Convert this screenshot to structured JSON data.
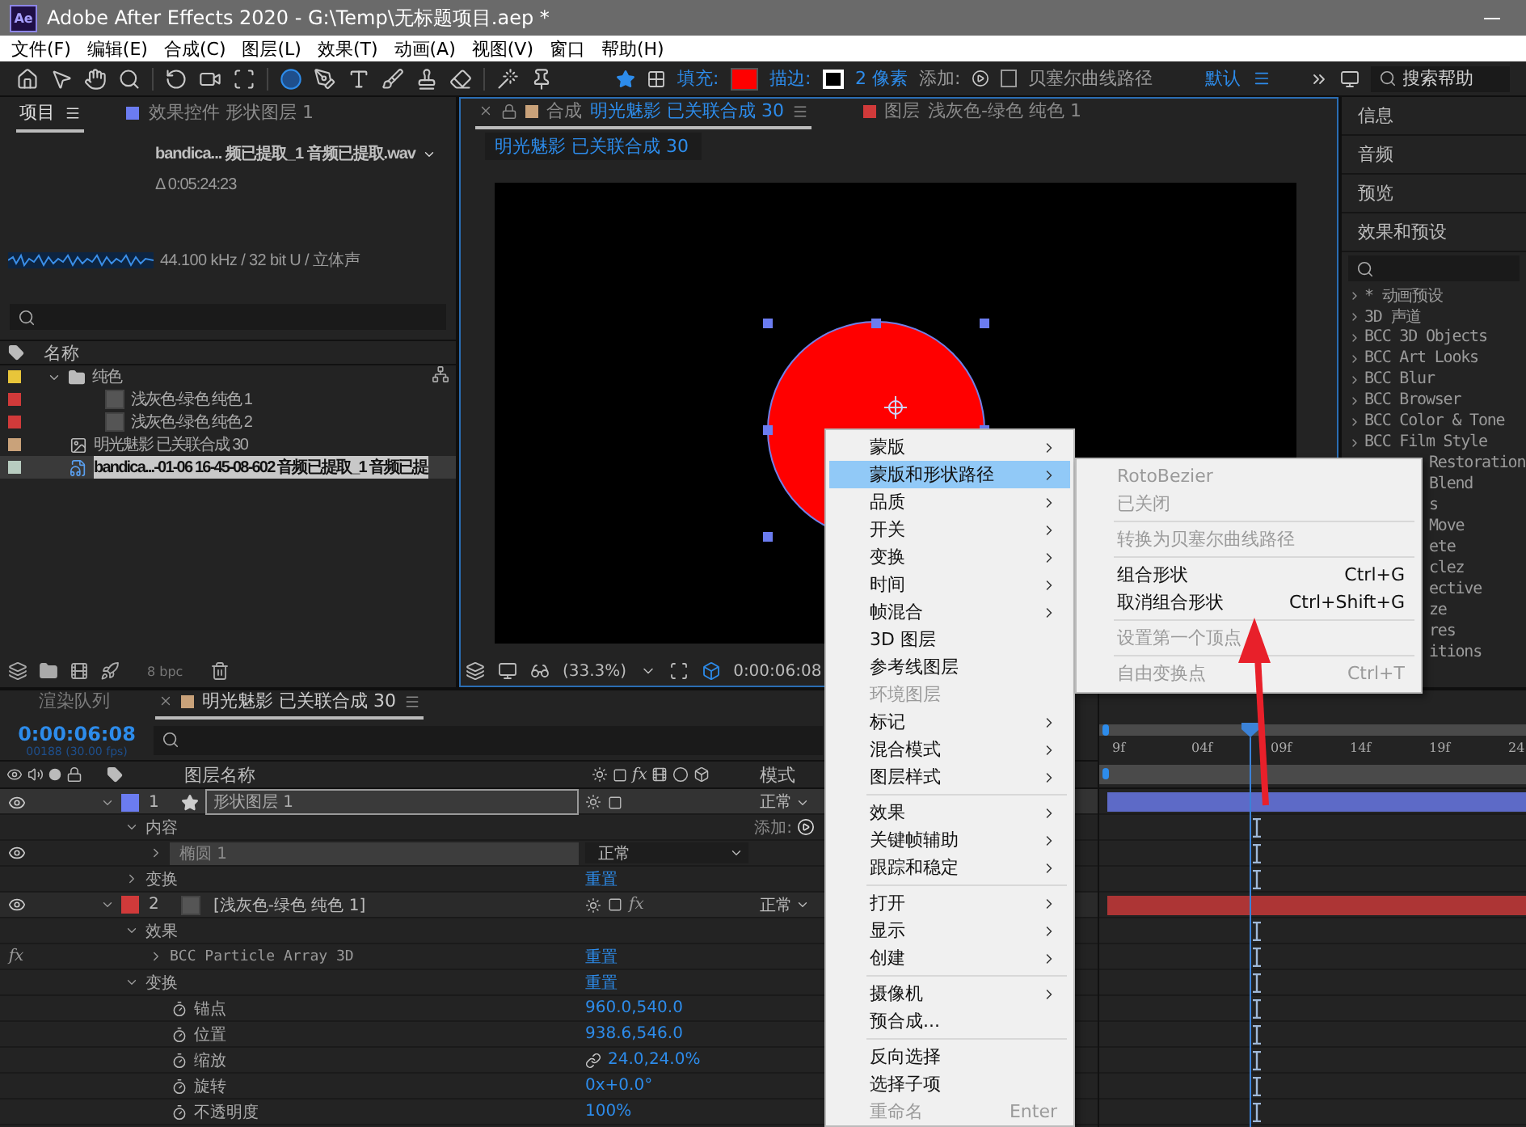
{
  "window": {
    "logo": "Ae",
    "title": "Adobe After Effects 2020 - G:\\Temp\\无标题项目.aep *"
  },
  "menu_bar": [
    "文件(F)",
    "编辑(E)",
    "合成(C)",
    "图层(L)",
    "效果(T)",
    "动画(A)",
    "视图(V)",
    "窗口",
    "帮助(H)"
  ],
  "toolbar": {
    "tools": [
      {
        "kind": "home",
        "selected": false
      },
      {
        "kind": "select",
        "selected": false
      },
      {
        "kind": "hand",
        "selected": false
      },
      {
        "kind": "zoom",
        "selected": false
      },
      {
        "kind": "rotate",
        "selected": false
      },
      {
        "kind": "camera",
        "selected": false
      },
      {
        "kind": "pan",
        "selected": false
      },
      {
        "kind": "ellipse",
        "selected": true
      },
      {
        "kind": "pen",
        "selected": false
      },
      {
        "kind": "text",
        "selected": false
      },
      {
        "kind": "brush",
        "selected": false
      },
      {
        "kind": "stamp",
        "selected": false
      },
      {
        "kind": "eraser",
        "selected": false
      },
      {
        "kind": "roto",
        "selected": false
      },
      {
        "kind": "pin",
        "selected": false
      }
    ],
    "fill_label": "填充:",
    "stroke_label": "描边:",
    "stroke_width": "2 像素",
    "add_label": "添加:",
    "bezier": {
      "label": "贝塞尔曲线路径",
      "checked": false
    },
    "workspace": "默认",
    "search": {
      "placeholder": "搜索帮助"
    }
  },
  "project_panel": {
    "tabs": [
      {
        "label": "项目",
        "selected": true
      },
      {
        "label": "效果控件 形状图层 1",
        "selected": false
      }
    ],
    "file_name": "bandica... 频已提取_1 音频已提取.wav",
    "duration": "Δ 0:05:24:23",
    "audio_info": "44.100 kHz / 32 bit U / 立体声",
    "column": "名称",
    "items": [
      {
        "kind": "folder",
        "name": "纯色",
        "color": "#e8c53a",
        "expanded": true,
        "selected": false,
        "children": [
          {
            "kind": "solid",
            "name": "浅灰色-绿色 纯色 1",
            "color": "#d03a3a",
            "selected": false
          },
          {
            "kind": "solid",
            "name": "浅灰色-绿色 纯色 2",
            "color": "#d03a3a",
            "selected": false
          }
        ]
      },
      {
        "kind": "comp",
        "name": "明光魅影 已关联合成 30",
        "color": "#c9a27a",
        "selected": false
      },
      {
        "kind": "audio",
        "name": "bandica...-01-06 16-45-08-602 音频已提取_1 音频已提",
        "color": "#b8ccc0",
        "selected": true
      }
    ],
    "bit_depth": "8 bpc"
  },
  "composition_panel": {
    "tabs": [
      {
        "prefix": "合成",
        "name": "明光魅影 已关联合成 30",
        "color": "#c9a27a",
        "selected": true
      },
      {
        "prefix": "图层",
        "name": "浅灰色-绿色 纯色 1",
        "color": "#d03a3a",
        "selected": false
      }
    ],
    "breadcrumb": "明光魅影 已关联合成 30",
    "zoom": "(33.3%)",
    "timecode": "0:00:06:08"
  },
  "side_panels": {
    "sections": [
      "信息",
      "音频",
      "预览"
    ],
    "effects_title": "效果和预设",
    "effects": [
      {
        "kind": "full",
        "label": "* 动画预设"
      },
      {
        "kind": "full",
        "label": "3D 声道"
      },
      {
        "kind": "full",
        "label": "BCC 3D Objects"
      },
      {
        "kind": "full",
        "label": "BCC Art Looks"
      },
      {
        "kind": "full",
        "label": "BCC Blur"
      },
      {
        "kind": "full",
        "label": "BCC Browser"
      },
      {
        "kind": "full",
        "label": "BCC Color & Tone"
      },
      {
        "kind": "full",
        "label": "BCC Film Style"
      },
      {
        "kind": "cut",
        "label": "Restoration"
      },
      {
        "kind": "cut",
        "label": "Blend"
      },
      {
        "kind": "cut",
        "label": "s"
      },
      {
        "kind": "cut",
        "label": "Move"
      },
      {
        "kind": "cut",
        "label": "ete"
      },
      {
        "kind": "cut",
        "label": "clez"
      },
      {
        "kind": "cut",
        "label": "ective"
      },
      {
        "kind": "cut",
        "label": "ze"
      },
      {
        "kind": "cut",
        "label": "res"
      },
      {
        "kind": "cut",
        "label": "itions"
      }
    ]
  },
  "timeline": {
    "tabs": [
      {
        "label": "渲染队列",
        "selected": false
      },
      {
        "label": "明光魅影 已关联合成 30",
        "color": "#c9a27a",
        "selected": true
      }
    ],
    "current_time": "0:00:06:08",
    "frame_info": "00188 (30.00 fps)",
    "columns": {
      "name": "图层名称",
      "effects": "fx",
      "mode": "模式"
    },
    "ruler": [
      "9f",
      "04f",
      "09f",
      "14f",
      "19f",
      "24"
    ],
    "layers": [
      {
        "kind": "shape_layer",
        "number": "1",
        "name": "形状图层 1",
        "color": "#6b7cf0",
        "visible": true,
        "selected": true,
        "expanded": true,
        "mode": "正常",
        "children": [
          {
            "kind": "group",
            "name": "内容",
            "expanded": true,
            "add_label": "添加:",
            "children": [
              {
                "kind": "shape",
                "name": "椭圆 1",
                "visible": true,
                "expanded": false,
                "mode": "正常"
              }
            ]
          },
          {
            "kind": "group",
            "name": "变换",
            "expanded": false,
            "value": "重置"
          }
        ]
      },
      {
        "kind": "solid_layer",
        "number": "2",
        "name": "[浅灰色-绿色 纯色 1]",
        "color": "#d03a3a",
        "visible": true,
        "selected": false,
        "expanded": true,
        "mode": "正常",
        "fx": "fx",
        "children": [
          {
            "kind": "group",
            "name": "效果",
            "expanded": true,
            "children": [
              {
                "kind": "effect",
                "badge": "fx",
                "name": "BCC Particle Array 3D",
                "expanded": false,
                "value": "重置"
              }
            ]
          },
          {
            "kind": "group",
            "name": "变换",
            "expanded": true,
            "value": "重置",
            "children": [
              {
                "kind": "property",
                "name": "锚点",
                "value": "960.0,540.0",
                "linked": false
              },
              {
                "kind": "property",
                "name": "位置",
                "value": "938.6,546.0",
                "linked": false
              },
              {
                "kind": "property",
                "name": "缩放",
                "value": "24.0,24.0%",
                "linked": true
              },
              {
                "kind": "property",
                "name": "旋转",
                "value": "0x+0.0°",
                "linked": false
              },
              {
                "kind": "property",
                "name": "不透明度",
                "value": "100%",
                "linked": false
              }
            ]
          }
        ]
      }
    ]
  },
  "context_menu": {
    "items": [
      {
        "kind": "submenu",
        "label": "蒙版",
        "selected": false,
        "disabled": false
      },
      {
        "kind": "submenu",
        "label": "蒙版和形状路径",
        "selected": true,
        "disabled": false
      },
      {
        "kind": "submenu",
        "label": "品质",
        "selected": false,
        "disabled": false
      },
      {
        "kind": "submenu",
        "label": "开关",
        "selected": false,
        "disabled": false
      },
      {
        "kind": "submenu",
        "label": "变换",
        "selected": false,
        "disabled": false
      },
      {
        "kind": "submenu",
        "label": "时间",
        "selected": false,
        "disabled": false
      },
      {
        "kind": "submenu",
        "label": "帧混合",
        "selected": false,
        "disabled": false
      },
      {
        "kind": "item",
        "label": "3D 图层",
        "selected": false,
        "disabled": false
      },
      {
        "kind": "item",
        "label": "参考线图层",
        "selected": false,
        "disabled": false
      },
      {
        "kind": "item",
        "label": "环境图层",
        "selected": false,
        "disabled": true
      },
      {
        "kind": "submenu",
        "label": "标记",
        "selected": false,
        "disabled": false
      },
      {
        "kind": "submenu",
        "label": "混合模式",
        "selected": false,
        "disabled": false
      },
      {
        "kind": "submenu",
        "label": "图层样式",
        "selected": false,
        "disabled": false
      },
      {
        "kind": "separator"
      },
      {
        "kind": "submenu",
        "label": "效果",
        "selected": false,
        "disabled": false
      },
      {
        "kind": "submenu",
        "label": "关键帧辅助",
        "selected": false,
        "disabled": false
      },
      {
        "kind": "submenu",
        "label": "跟踪和稳定",
        "selected": false,
        "disabled": false
      },
      {
        "kind": "separator"
      },
      {
        "kind": "submenu",
        "label": "打开",
        "selected": false,
        "disabled": false
      },
      {
        "kind": "submenu",
        "label": "显示",
        "selected": false,
        "disabled": false
      },
      {
        "kind": "submenu",
        "label": "创建",
        "selected": false,
        "disabled": false
      },
      {
        "kind": "separator"
      },
      {
        "kind": "submenu",
        "label": "摄像机",
        "selected": false,
        "disabled": false
      },
      {
        "kind": "item",
        "label": "预合成...",
        "selected": false,
        "disabled": false
      },
      {
        "kind": "separator"
      },
      {
        "kind": "item",
        "label": "反向选择",
        "selected": false,
        "disabled": false
      },
      {
        "kind": "item",
        "label": "选择子项",
        "selected": false,
        "disabled": false
      },
      {
        "kind": "item",
        "label": "重命名",
        "shortcut": "Enter",
        "selected": false,
        "disabled": true
      }
    ]
  },
  "submenu": {
    "items": [
      {
        "kind": "item",
        "label": "RotoBezier",
        "disabled": true
      },
      {
        "kind": "item",
        "label": "已关闭",
        "disabled": true
      },
      {
        "kind": "separator"
      },
      {
        "kind": "item",
        "label": "转换为贝塞尔曲线路径",
        "disabled": true
      },
      {
        "kind": "separator"
      },
      {
        "kind": "item",
        "label": "组合形状",
        "shortcut": "Ctrl+G",
        "disabled": false
      },
      {
        "kind": "item",
        "label": "取消组合形状",
        "shortcut": "Ctrl+Shift+G",
        "disabled": false
      },
      {
        "kind": "separator"
      },
      {
        "kind": "item",
        "label": "设置第一个顶点",
        "disabled": true
      },
      {
        "kind": "separator"
      },
      {
        "kind": "item",
        "label": "自由变换点",
        "shortcut": "Ctrl+T",
        "disabled": true
      }
    ]
  }
}
